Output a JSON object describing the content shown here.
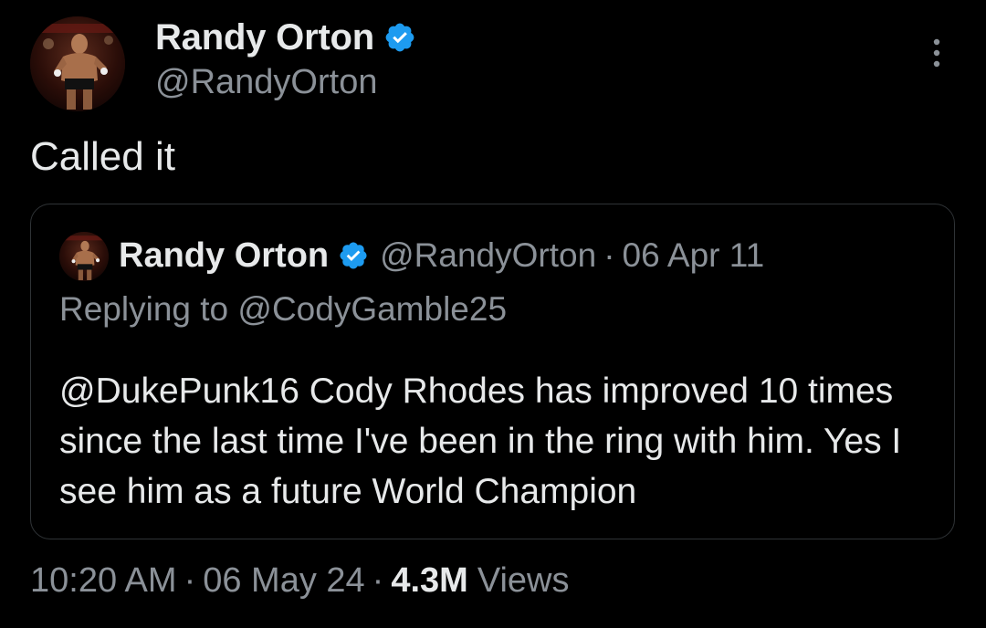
{
  "tweet": {
    "author": {
      "display_name": "Randy Orton",
      "handle": "@RandyOrton",
      "verified_icon": "verified-badge-icon",
      "avatar": "wrestler-avatar"
    },
    "more_icon": "more-vertical-icon",
    "text": "Called it"
  },
  "quote": {
    "author": {
      "display_name": "Randy Orton",
      "handle": "@RandyOrton",
      "verified_icon": "verified-badge-icon"
    },
    "separator": "·",
    "date": "06 Apr 11",
    "replying_prefix": "Replying to",
    "replying_to": "@CodyGamble25",
    "text": "@DukePunk16 Cody Rhodes has improved 10 times since the last time I've been in the ring with him. Yes I see him as a future World Champion"
  },
  "footer": {
    "time": "10:20 AM",
    "date": "06 May 24",
    "separator": "·",
    "views_count": "4.3M",
    "views_label": "Views"
  },
  "colors": {
    "background": "#000000",
    "primary_text": "#e7e9ea",
    "secondary_text": "#8b9198",
    "border": "#2f3336",
    "verified_blue": "#1d9bf0"
  }
}
